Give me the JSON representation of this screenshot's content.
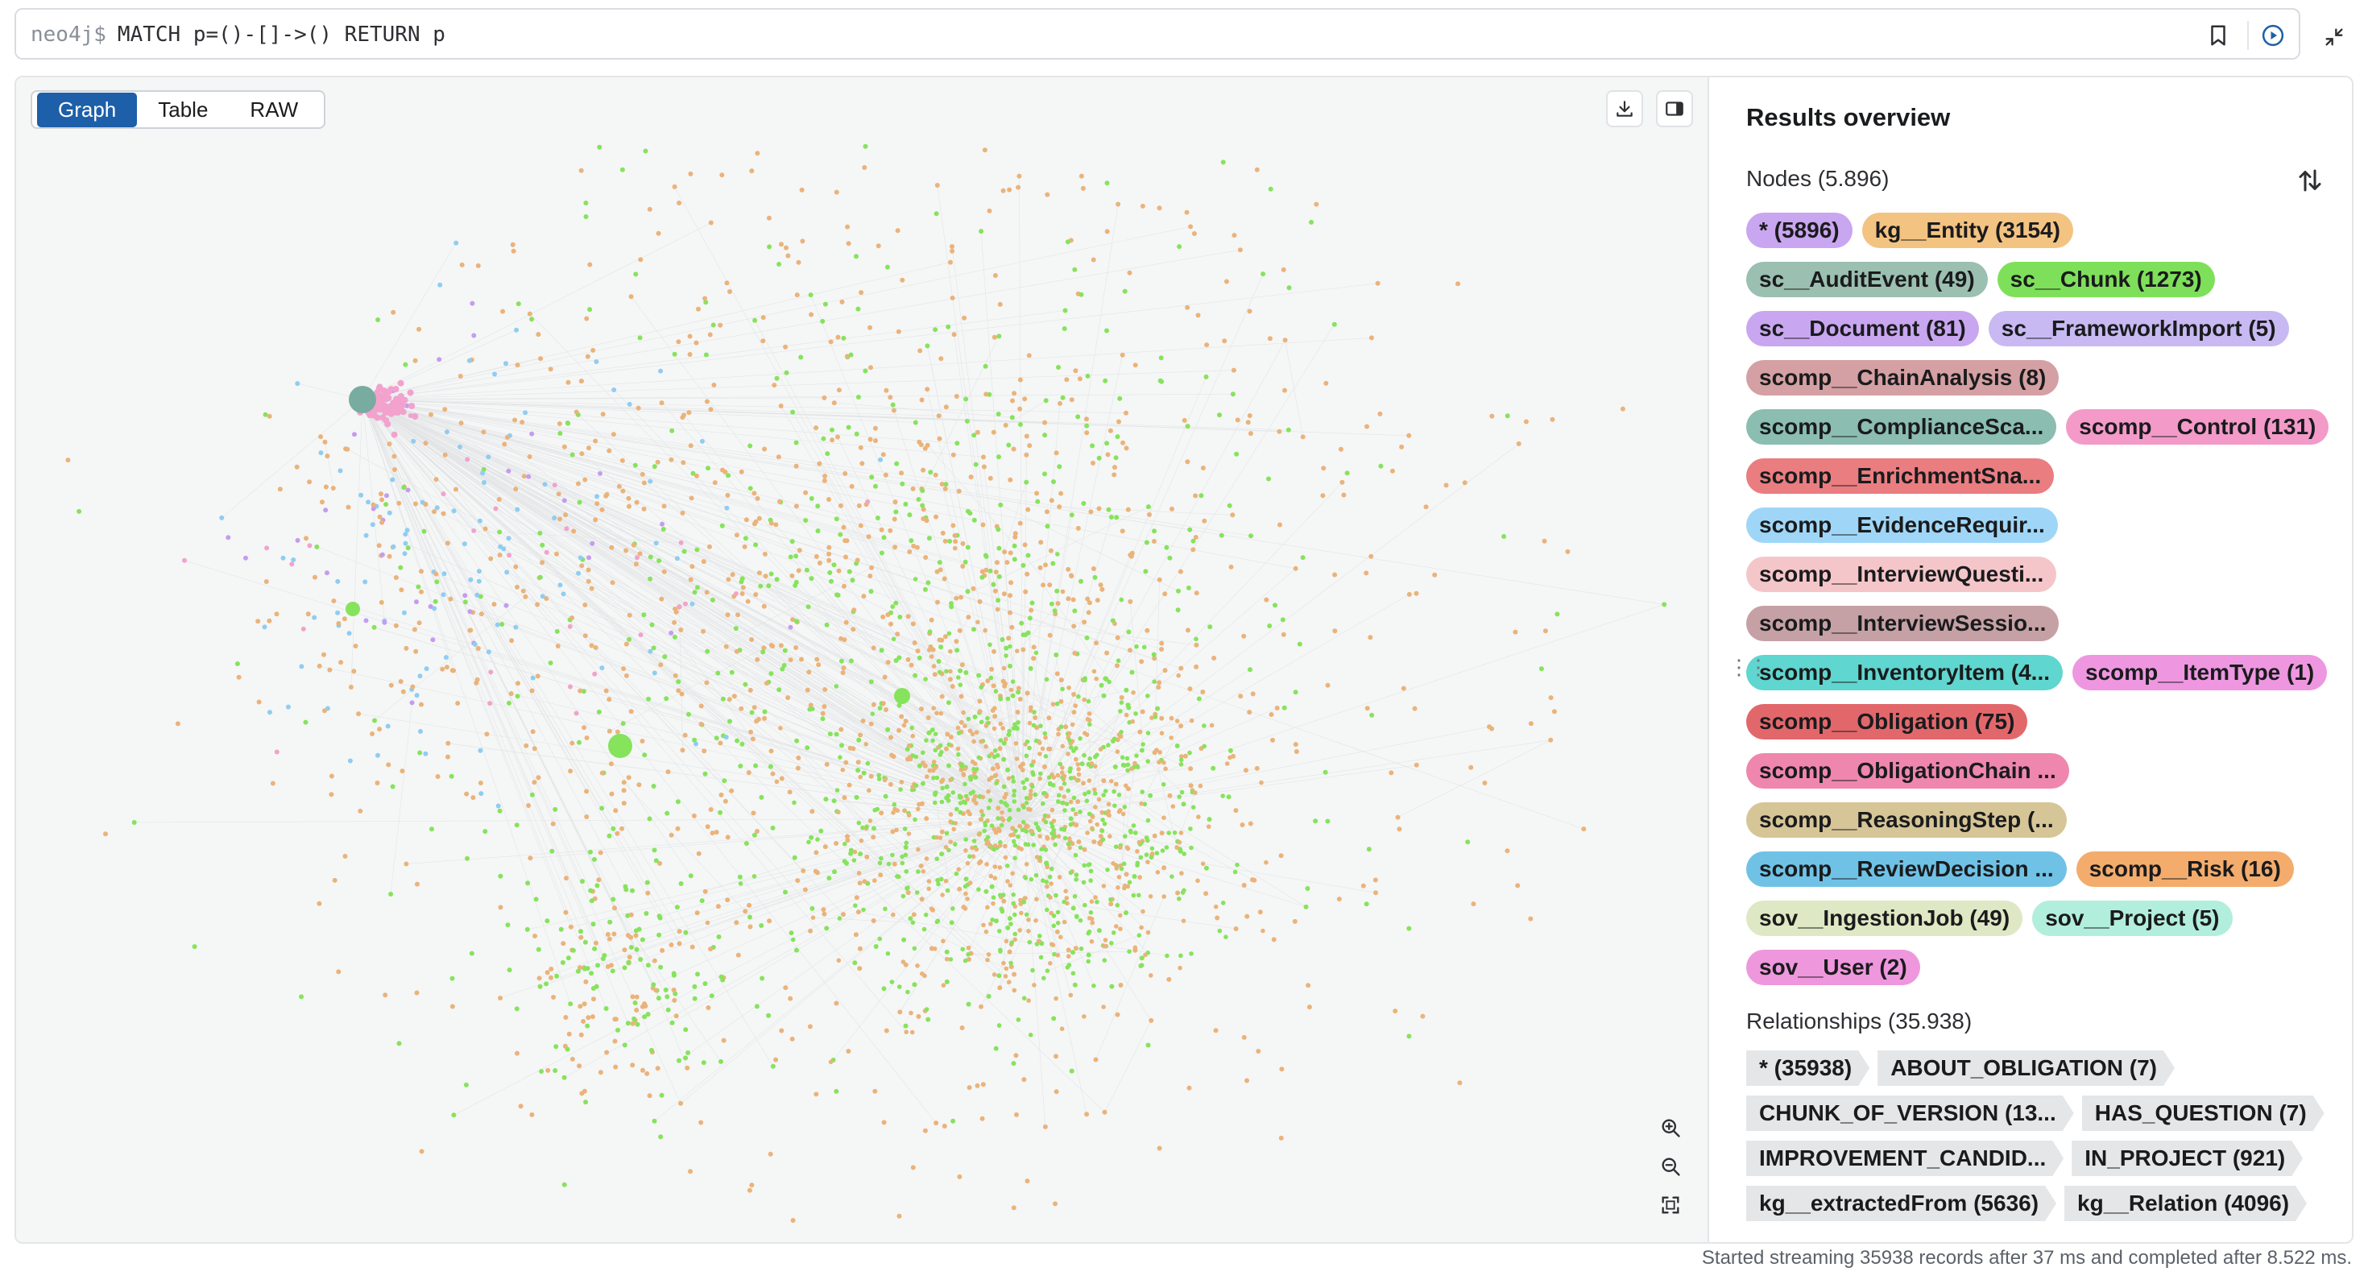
{
  "editor": {
    "prompt": "neo4j$",
    "query": "MATCH p=()-[]->() RETURN p"
  },
  "view_tabs": [
    "Graph",
    "Table",
    "RAW"
  ],
  "active_tab": "Graph",
  "results": {
    "title": "Results overview",
    "nodes_label": "Nodes (5.896)",
    "node_rows": [
      [
        {
          "label": "* (5896)",
          "color": "#c9a6f0"
        },
        {
          "label": "kg__Entity (3154)",
          "color": "#f3c382"
        }
      ],
      [
        {
          "label": "sc__AuditEvent (49)",
          "color": "#9bbfb0"
        },
        {
          "label": "sc__Chunk (1273)",
          "color": "#7ee05a"
        }
      ],
      [
        {
          "label": "sc__Document (81)",
          "color": "#c9a6f0"
        },
        {
          "label": "sc__FrameworkImport (5)",
          "color": "#c8b9f3"
        }
      ],
      [
        {
          "label": "scomp__ChainAnalysis (8)",
          "color": "#d4a0a3"
        }
      ],
      [
        {
          "label": "scomp__ComplianceSca...",
          "color": "#8bbdb0"
        },
        {
          "label": "scomp__Control (131)",
          "color": "#f39ac9"
        }
      ],
      [
        {
          "label": "scomp__EnrichmentSna...",
          "color": "#ea7d80"
        }
      ],
      [
        {
          "label": "scomp__EvidenceRequir...",
          "color": "#9fd6f7"
        }
      ],
      [
        {
          "label": "scomp__InterviewQuesti...",
          "color": "#f5c6c9"
        }
      ],
      [
        {
          "label": "scomp__InterviewSessio...",
          "color": "#c5a1a5"
        }
      ],
      [
        {
          "label": "scomp__InventoryItem (4...",
          "color": "#5fd6cf"
        },
        {
          "label": "scomp__ItemType (1)",
          "color": "#ee97e0"
        }
      ],
      [
        {
          "label": "scomp__Obligation (75)",
          "color": "#e2676b"
        }
      ],
      [
        {
          "label": "scomp__ObligationChain ...",
          "color": "#ef86ad"
        }
      ],
      [
        {
          "label": "scomp__ReasoningStep (...",
          "color": "#d6c596"
        }
      ],
      [
        {
          "label": "scomp__ReviewDecision ...",
          "color": "#6fc2e6"
        },
        {
          "label": "scomp__Risk (16)",
          "color": "#f3ac6c"
        }
      ],
      [
        {
          "label": "sov__IngestionJob (49)",
          "color": "#dfe8c4"
        },
        {
          "label": "sov__Project (5)",
          "color": "#b2eedc"
        }
      ],
      [
        {
          "label": "sov__User (2)",
          "color": "#ef97dd"
        }
      ]
    ],
    "relationships_label": "Relationships (35.938)",
    "rel_rows": [
      [
        "* (35938)",
        "ABOUT_OBLIGATION (7)"
      ],
      [
        "CHUNK_OF_VERSION (13...",
        "HAS_QUESTION (7)"
      ],
      [
        "IMPROVEMENT_CANDID...",
        "IN_PROJECT (921)"
      ],
      [
        "kg__extractedFrom (5636)",
        "kg__Relation (4096)"
      ]
    ]
  },
  "status_text": "Started streaming 35938 records after 37 ms and completed after 8.522 ms.",
  "icons": {
    "bookmark": "bookmark-icon",
    "run": "run-query-icon",
    "collapse": "collapse-icon",
    "download": "download-icon",
    "panel_toggle": "panel-toggle-icon",
    "sort": "sort-icon",
    "zoom_in": "zoom-in-icon",
    "zoom_out": "zoom-out-icon",
    "fit": "fit-to-screen-icon"
  },
  "graph_colors": {
    "entity": "#eab37a",
    "chunk": "#86e35c",
    "evidence": "#8fcdf2",
    "control": "#f2a2cc",
    "document": "#c59cf0",
    "audit": "#78aca0",
    "edge": "#d4d6d9"
  }
}
